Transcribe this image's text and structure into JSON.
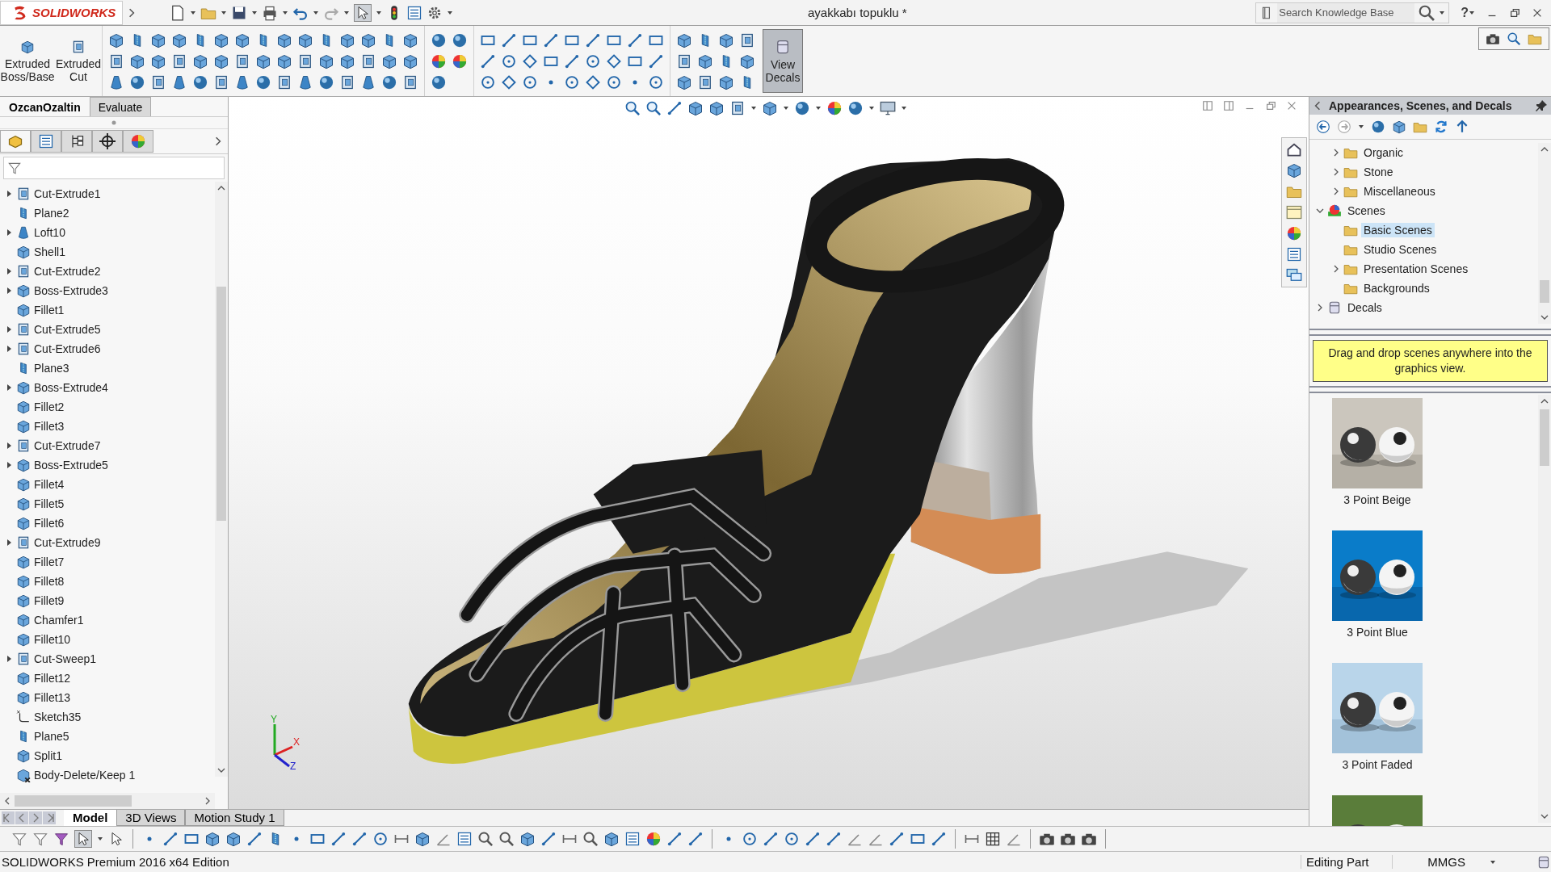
{
  "app": {
    "logo_text": "SOLIDWORKS"
  },
  "document_title": "ayakkabı topuklu *",
  "search": {
    "placeholder": "Search Knowledge Base"
  },
  "help_label": "?",
  "ribbon": {
    "buttons": [
      {
        "label": "Extruded Boss/Base"
      },
      {
        "label": "Extruded Cut"
      }
    ],
    "view_decals": {
      "label": "View Decals",
      "selected": true
    }
  },
  "command_tabs": [
    {
      "label": "OzcanOzaltin",
      "selected": true
    },
    {
      "label": "Evaluate",
      "selected": false
    }
  ],
  "panel_tabs": [
    {
      "selected": true
    },
    {
      "selected": false
    },
    {
      "selected": false
    },
    {
      "selected": false
    },
    {
      "selected": false
    }
  ],
  "feature_tree": [
    {
      "label": "Cut-Extrude1",
      "kind": "cut",
      "expandable": true
    },
    {
      "label": "Plane2",
      "kind": "plane",
      "expandable": false
    },
    {
      "label": "Loft10",
      "kind": "loft",
      "expandable": true
    },
    {
      "label": "Shell1",
      "kind": "solid",
      "expandable": false
    },
    {
      "label": "Cut-Extrude2",
      "kind": "cut",
      "expandable": true
    },
    {
      "label": "Boss-Extrude3",
      "kind": "solid",
      "expandable": true
    },
    {
      "label": "Fillet1",
      "kind": "solid",
      "expandable": false
    },
    {
      "label": "Cut-Extrude5",
      "kind": "cut",
      "expandable": true
    },
    {
      "label": "Cut-Extrude6",
      "kind": "cut",
      "expandable": true
    },
    {
      "label": "Plane3",
      "kind": "plane",
      "expandable": false
    },
    {
      "label": "Boss-Extrude4",
      "kind": "solid",
      "expandable": true
    },
    {
      "label": "Fillet2",
      "kind": "solid",
      "expandable": false
    },
    {
      "label": "Fillet3",
      "kind": "solid",
      "expandable": false
    },
    {
      "label": "Cut-Extrude7",
      "kind": "cut",
      "expandable": true
    },
    {
      "label": "Boss-Extrude5",
      "kind": "solid",
      "expandable": true
    },
    {
      "label": "Fillet4",
      "kind": "solid",
      "expandable": false
    },
    {
      "label": "Fillet5",
      "kind": "solid",
      "expandable": false
    },
    {
      "label": "Fillet6",
      "kind": "solid",
      "expandable": false
    },
    {
      "label": "Cut-Extrude9",
      "kind": "cut",
      "expandable": true
    },
    {
      "label": "Fillet7",
      "kind": "solid",
      "expandable": false
    },
    {
      "label": "Fillet8",
      "kind": "solid",
      "expandable": false
    },
    {
      "label": "Fillet9",
      "kind": "solid",
      "expandable": false
    },
    {
      "label": "Chamfer1",
      "kind": "solid",
      "expandable": false
    },
    {
      "label": "Fillet10",
      "kind": "solid",
      "expandable": false
    },
    {
      "label": "Cut-Sweep1",
      "kind": "cut",
      "expandable": true
    },
    {
      "label": "Fillet12",
      "kind": "solid",
      "expandable": false
    },
    {
      "label": "Fillet13",
      "kind": "solid",
      "expandable": false
    },
    {
      "label": "Sketch35",
      "kind": "sketch",
      "expandable": false
    },
    {
      "label": "Plane5",
      "kind": "plane",
      "expandable": false
    },
    {
      "label": "Split1",
      "kind": "solid",
      "expandable": false
    },
    {
      "label": "Body-Delete/Keep 1",
      "kind": "delete",
      "expandable": false
    }
  ],
  "triad_labels": [
    "Y",
    "X",
    "Z"
  ],
  "task_pane": {
    "title": "Appearances, Scenes, and Decals",
    "branch_items": [
      {
        "label": "Organic",
        "kind": "folder",
        "expandable": true,
        "expanded": false,
        "selected": false
      },
      {
        "label": "Stone",
        "kind": "folder",
        "expandable": true,
        "expanded": false,
        "selected": false
      },
      {
        "label": "Miscellaneous",
        "kind": "folder",
        "expandable": true,
        "expanded": false,
        "selected": false
      }
    ],
    "tree": [
      {
        "label": "Scenes",
        "kind": "scenes",
        "expandable": true,
        "expanded": true,
        "selected": false,
        "children": [
          {
            "label": "Basic Scenes",
            "kind": "folder",
            "expandable": false,
            "selected": true
          },
          {
            "label": "Studio Scenes",
            "kind": "folder",
            "expandable": false,
            "selected": false
          },
          {
            "label": "Presentation Scenes",
            "kind": "folder",
            "expandable": true,
            "expanded": false,
            "selected": false
          },
          {
            "label": "Backgrounds",
            "kind": "folder",
            "expandable": false,
            "selected": false
          }
        ]
      },
      {
        "label": "Decals",
        "kind": "decals",
        "expandable": true,
        "expanded": false,
        "selected": false
      }
    ],
    "hint": "Drag and drop scenes anywhere into the graphics view.",
    "thumbnails": [
      {
        "label": "3 Point Beige"
      },
      {
        "label": "3 Point Blue"
      },
      {
        "label": "3 Point Faded"
      }
    ]
  },
  "model_tabs": [
    {
      "label": "Model",
      "selected": true
    },
    {
      "label": "3D Views",
      "selected": false
    },
    {
      "label": "Motion Study 1",
      "selected": false
    }
  ],
  "status_bar": {
    "edition": "SOLIDWORKS Premium 2016 x64 Edition",
    "mode": "Editing Part",
    "units": "MMGS"
  }
}
